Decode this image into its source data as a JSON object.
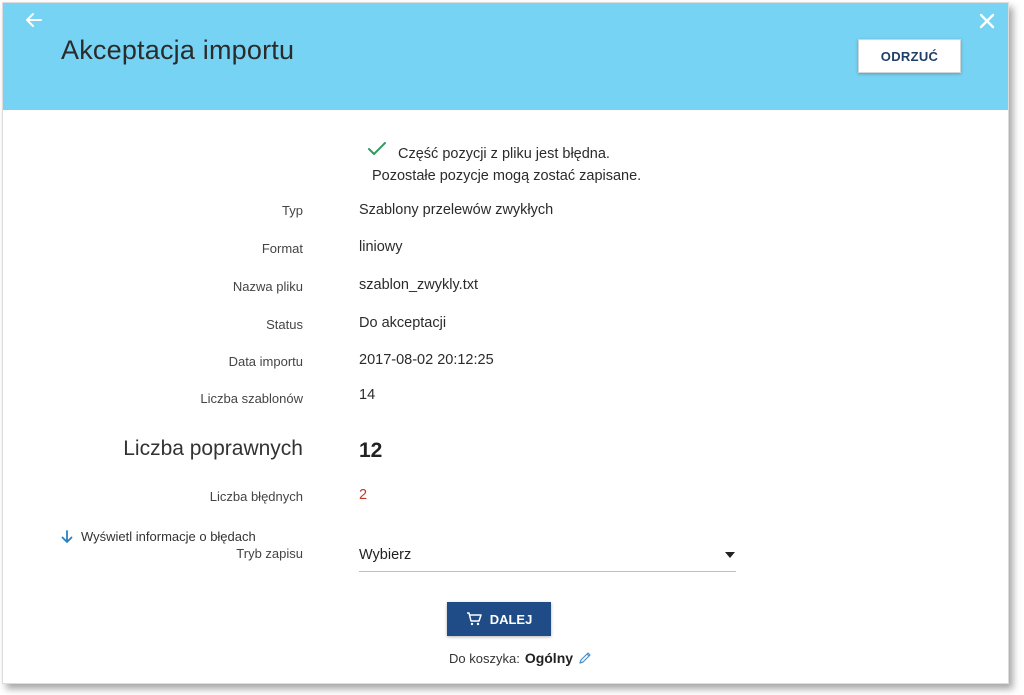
{
  "header": {
    "title": "Akceptacja importu",
    "reject_label": "ODRZUĆ"
  },
  "message": {
    "line1": "Część pozycji z pliku jest błędna.",
    "line2": "Pozostałe pozycje mogą zostać zapisane."
  },
  "details": [
    {
      "label": "Typ",
      "value": "Szablony przelewów zwykłych"
    },
    {
      "label": "Format",
      "value": "liniowy"
    },
    {
      "label": "Nazwa pliku",
      "value": "szablon_zwykly.txt"
    },
    {
      "label": "Status",
      "value": "Do akceptacji"
    },
    {
      "label": "Data importu",
      "value": "2017-08-02 20:12:25"
    },
    {
      "label": "Liczba szablonów",
      "value": "14"
    }
  ],
  "correct": {
    "label": "Liczba poprawnych",
    "value": "12"
  },
  "errors": {
    "label": "Liczba błędnych",
    "value": "2"
  },
  "error_info_link": "Wyświetl informacje o błędach",
  "save_mode": {
    "label": "Tryb zapisu",
    "selected": "Wybierz"
  },
  "next_label": "DALEJ",
  "basket": {
    "label": "Do koszyka:",
    "value": "Ogólny"
  },
  "colors": {
    "header": "#76d3f3",
    "primary": "#1f4b86",
    "error": "#c0392b",
    "success": "#2e9b5e"
  },
  "icons": [
    "back-arrow-icon",
    "close-icon",
    "check-icon",
    "arrow-down-icon",
    "chevron-down-icon",
    "cart-icon",
    "pencil-icon"
  ]
}
